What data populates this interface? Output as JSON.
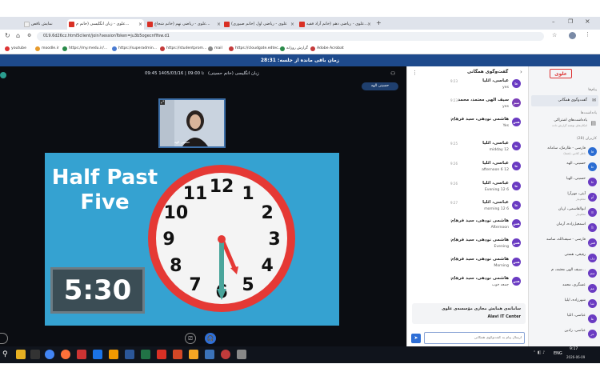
{
  "browser": {
    "tabs": [
      {
        "label": "نمایش ناقص",
        "active": false
      },
      {
        "label": "علوی - زبان انگلیسی (خانم م...",
        "active": true
      },
      {
        "label": "علوی - ریاضی نهم (خانم شجاع...",
        "active": false
      },
      {
        "label": "علوی - ریاضی اول (خانم صبوری)",
        "active": false
      },
      {
        "label": "علوی - ریاضی دهم (خانم آزاد فقیه...",
        "active": false
      }
    ],
    "address": "019.6d26cz.html5client/join?sessionToken=ju3b5ogecnflfsw.d1",
    "bookmarks": [
      "youtube",
      "moodle.ir",
      "https://my.medu.ir/...",
      "https://superadmin...",
      "https://studentprom...",
      "mail",
      "https://cloudgate.edtec...",
      "گزارش روزانه",
      "Adobe Acrobat"
    ]
  },
  "timer": {
    "label": "زمان باقی مانده از جلسه: 28:31"
  },
  "session": {
    "datetime": "09:45 تا 09:00 | 1405/03/16",
    "title": "زبان انگلیسی (خانم حسینی)",
    "presenter_badge": "حسینی الهه",
    "webcam_name": "حسینی الهه"
  },
  "slide": {
    "title_line1": "Half Past",
    "title_line2": "Five",
    "time_display": "5:30",
    "clock_numbers": [
      "12",
      "1",
      "2",
      "3",
      "4",
      "5",
      "6",
      "7",
      "8",
      "9",
      "10",
      "11"
    ]
  },
  "chat": {
    "header": "گفت‌وگوی همگانی",
    "messages": [
      {
        "name": "عباسی، ائلیا",
        "time": "9:23",
        "text": "yes",
        "initials": "عا",
        "color": "#6a3bc2"
      },
      {
        "name": "سیف الهی معتمد، محمد",
        "time": "9:23",
        "text": "yes",
        "initials": "سم",
        "color": "#7b3fb8"
      },
      {
        "name": "هاشمی نودهی، سید فرهام",
        "time": "9:24",
        "text": "Yes",
        "initials": "هس",
        "color": "#6a3bc2"
      },
      {
        "name": "عباسی، ائلیا",
        "time": "9:25",
        "text": "midday 12",
        "initials": "عا",
        "color": "#6a3bc2"
      },
      {
        "name": "عباسی، ائلیا",
        "time": "9:26",
        "text": "afternoon 6 12",
        "initials": "عا",
        "color": "#6a3bc2"
      },
      {
        "name": "عباسی، ائلیا",
        "time": "9:26",
        "text": "Evening 12 6",
        "initials": "عا",
        "color": "#6a3bc2"
      },
      {
        "name": "عباسی، ائلیا",
        "time": "9:27",
        "text": "morning 12 6",
        "initials": "عا",
        "color": "#6a3bc2"
      },
      {
        "name": "هاشمی نودهی، سید فرهام",
        "time": "9:27",
        "text": "Afternoon",
        "initials": "هس",
        "color": "#6a3bc2"
      },
      {
        "name": "هاشمی نودهی، سید فرهام",
        "time": "9:27",
        "text": "Evening",
        "initials": "هس",
        "color": "#6a3bc2"
      },
      {
        "name": "هاشمی نودهی، سید فرهام",
        "time": "9:28",
        "text": "Morning",
        "initials": "هس",
        "color": "#6a3bc2"
      },
      {
        "name": "هاشمی نودهی، سید فرهام",
        "time": "9:29",
        "text": "جمعه خوب",
        "initials": "هس",
        "color": "#6a3bc2"
      }
    ],
    "footer_title": "سامانه‌ی همایش مجازی مؤسسه‌ی علوی",
    "footer_sub": "Alavi IT Center",
    "input_placeholder": "ارسال پیام به گفت‌وگوی همگانی"
  },
  "sidebar": {
    "logo": "علوی",
    "messages_heading": "پیام‌ها",
    "public_chat": "گفت‌وگوی همگانی",
    "notes_heading": "یادداشت‌ها",
    "shared_notes": "یادداشت‌های اشتراکی",
    "shared_notes_sub": "امکان‌های نوشته گزارش داده",
    "users_heading": "کاربران (28)",
    "users": [
      {
        "name": "فارسی - طارمک، سامانه",
        "role": "(شما)، ناظر کلاس",
        "initials": "فا",
        "color": "#2b6cd2"
      },
      {
        "name": "حسینی، الهه",
        "role": "",
        "initials": "حا",
        "color": "#2b6cd2"
      },
      {
        "name": "حسینی، الهیا",
        "role": "",
        "initials": "حا",
        "color": "#6a3bc2"
      },
      {
        "name": "آیتی، مهرآرا",
        "role": "معلم‌بیار",
        "initials": "آم",
        "color": "#6a3bc2"
      },
      {
        "name": "ابوالقاسمی، اریان",
        "role": "معلم‌بیار",
        "initials": "اا",
        "color": "#6a3bc2"
      },
      {
        "name": "اسمعیل‌زاده، آرمان",
        "role": "",
        "initials": "اآ",
        "color": "#6a3bc2"
      },
      {
        "name": "فارسی - سیف‌الله، ساسد",
        "role": "",
        "initials": "فس",
        "color": "#6a3bc2"
      },
      {
        "name": "رفیعی، هستی",
        "role": "",
        "initials": "رف",
        "color": "#6a3bc2"
      },
      {
        "name": "سیف الهی معتمد، م...",
        "role": "",
        "initials": "سم",
        "color": "#6a3bc2"
      },
      {
        "name": "عسگری، محمد",
        "role": "",
        "initials": "عم",
        "color": "#6a3bc2"
      },
      {
        "name": "شهرزاده، ایلیا",
        "role": "",
        "initials": "شا",
        "color": "#6a3bc2"
      },
      {
        "name": "عباسی، ائلیا",
        "role": "",
        "initials": "عا",
        "color": "#6a3bc2"
      },
      {
        "name": "عباسی، رادین",
        "role": "",
        "initials": "عر",
        "color": "#6a3bc2"
      }
    ]
  },
  "taskbar": {
    "time": "9:17",
    "date": "2026-06-09",
    "lang": "ENG"
  },
  "colors": {
    "brand": "#1e4a8c",
    "slide_bg": "#3aa7d6",
    "clock_red": "#e53935",
    "avatar": "#6a3bc2"
  }
}
